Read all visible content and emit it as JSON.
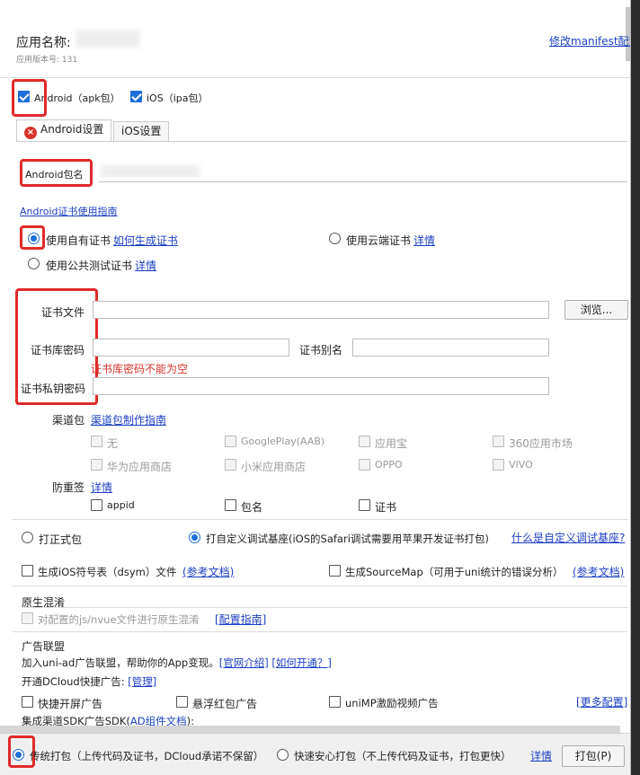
{
  "header": {
    "app_name_label": "应用名称:",
    "version_label": "应用版本号:",
    "version_value": "131",
    "modify_manifest": "修改manifest配置"
  },
  "platforms": {
    "android_label": "Android（apk包）",
    "ios_label": "iOS（ipa包）"
  },
  "tabs": [
    {
      "label": "Android设置"
    },
    {
      "label": "iOS设置"
    }
  ],
  "android": {
    "package_name_label": "Android包名",
    "cert_guide_link": "Android证书使用指南",
    "own_cert_label": "使用自有证书",
    "how_to_generate_link": "如何生成证书",
    "cloud_cert_label": "使用云端证书",
    "cloud_detail_link": "详情",
    "public_cert_label": "使用公共测试证书",
    "public_detail_link": "详情",
    "cert_file_label": "证书文件",
    "browse_button": "浏览...",
    "keystore_password_label": "证书库密码",
    "alias_label": "证书别名",
    "error_text": "证书库密码不能为空",
    "private_key_label": "证书私钥密码",
    "channel_label": "渠道包",
    "channel_guide_link": "渠道包制作指南",
    "channels": [
      "无",
      "GooglePlay(AAB)",
      "应用宝",
      "360应用市场",
      "华为应用商店",
      "小米应用商店",
      "OPPO",
      "VIVO"
    ],
    "anti_label": "防重签",
    "anti_detail_link": "详情",
    "anti_options": [
      "appid",
      "包名",
      "证书"
    ]
  },
  "build": {
    "formal_label": "打正式包",
    "custom_label": "打自定义调试基座(iOS的Safari调试需要用苹果开发证书打包)",
    "custom_help_link": "什么是自定义调试基座?",
    "dsym_label": "生成iOS符号表（dsym）文件",
    "dsym_ref_link": "(参考文档)",
    "sourcemap_label": "生成SourceMap（可用于uni统计的错误分析）",
    "sourcemap_ref_link": "(参考文档)"
  },
  "obfuscation": {
    "section_title": "原生混淆",
    "option_label": "对配置的js/nvue文件进行原生混淆",
    "guide_link": "[配置指南]"
  },
  "ads": {
    "section_title": "广告联盟",
    "intro_text": "加入uni-ad广告联盟，帮助你的App变现。",
    "official_link": "[官网介绍]",
    "how_link": "[如何开通？]",
    "dcloud_label": "开通DCloud快捷广告:",
    "manage_link": "[管理]",
    "splash_label": "快捷开屏广告",
    "float_label": "悬浮红包广告",
    "video_label": "uniMP激励视频广告",
    "more_link": "[更多配置]",
    "channel_sdk_label": "集成渠道SDK广告SDK(",
    "ad_doc_link": "AD组件文档",
    "channel_sdk_suffix": "):"
  },
  "footer": {
    "traditional_label": "传统打包（上传代码及证书，DCloud承诺不保留）",
    "safe_label": "快速安心打包（不上传代码及证书，打包更快）",
    "detail_link": "详情",
    "pack_button": "打包(P)"
  },
  "colors": {
    "accent": "#1e6fd9",
    "link": "#1a3fc4",
    "error": "#d9342b",
    "highlight": "#e02a2a"
  }
}
